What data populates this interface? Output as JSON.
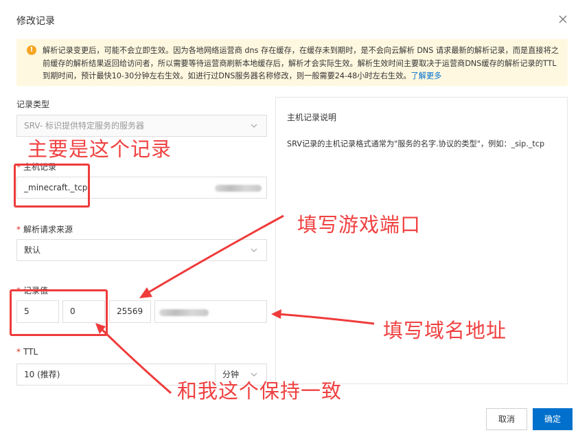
{
  "dialog": {
    "title": "修改记录",
    "close_icon": "close-icon"
  },
  "notice": {
    "text": "解析记录变更后，可能不会立即生效。因为各地网络运营商 dns 存在缓存，在缓存未到期时，是不会向云解析 DNS 请求最新的解析记录，而是直接将之前缓存的解析结果返回给访问者，所以需要等待运营商刷新本地缓存后，解析才会实际生效。解析生效时间主要取决于运营商DNS缓存的解析记录的TTL到期时间，预计最快10-30分钟左右生效。如进行过DNS服务器名称修改，则一般需要24-48小时左右生效。",
    "link": "了解更多"
  },
  "form": {
    "record_type_label": "记录类型",
    "record_type_value": "SRV- 标识提供特定服务的服务器",
    "host_label": "主机记录",
    "host_value": "_minecraft._tcp",
    "line_label": "解析请求来源",
    "line_value": "默认",
    "value_label": "记录值",
    "priority": "5",
    "weight": "0",
    "port": "25569",
    "ttl_label": "TTL",
    "ttl_value": "10 (推荐)",
    "ttl_unit": "分钟"
  },
  "help": {
    "title": "主机记录说明",
    "text": "SRV记录的主机记录格式通常为\"服务的名字.协议的类型\"，例如：_sip._tcp"
  },
  "buttons": {
    "cancel": "取消",
    "ok": "确定"
  },
  "annotations": {
    "main_record": "主要是这个记录",
    "port": "填写游戏端口",
    "domain": "填写域名地址",
    "consistent": "和我这个保持一致"
  },
  "colors": {
    "primary": "#0070cc",
    "annotation": "#f04141",
    "notice_bg": "#fff8e0"
  }
}
